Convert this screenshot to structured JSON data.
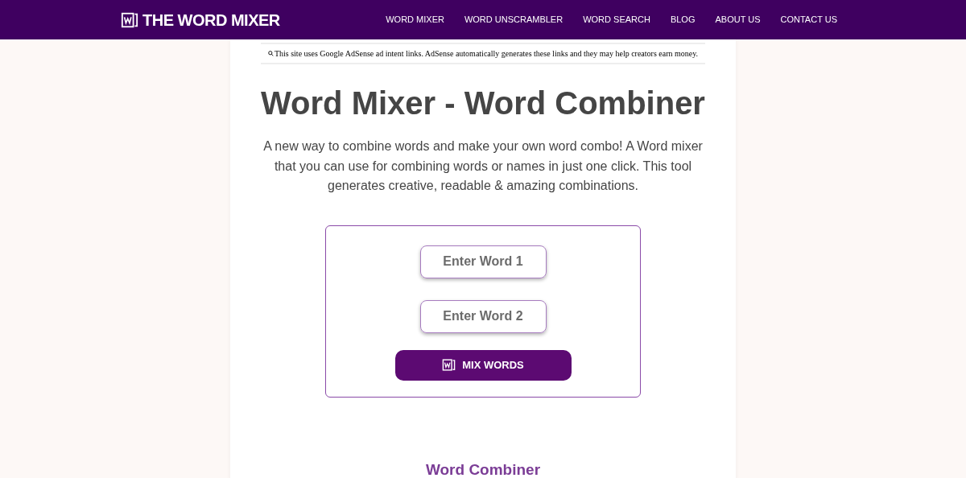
{
  "header": {
    "logo": "THE WORD MIXER",
    "nav": [
      {
        "label": "WORD MIXER"
      },
      {
        "label": "WORD UNSCRAMBLER"
      },
      {
        "label": "WORD SEARCH"
      },
      {
        "label": "BLOG"
      },
      {
        "label": "ABOUT US"
      },
      {
        "label": "CONTACT US"
      }
    ]
  },
  "notice": "This site uses Google AdSense ad intent links. AdSense automatically generates these links and they may help creators earn money.",
  "title": "Word Mixer - Word Combiner",
  "intro": "A new way to combine words and make your own word combo! A Word mixer that you can use for combining words or names in just one click. This tool generates creative, readable & amazing combinations.",
  "form": {
    "fields": [
      {
        "placeholder": "Enter Word 1"
      },
      {
        "placeholder": "Enter Word 2"
      }
    ],
    "button": "MIX WORDS"
  },
  "section_heading": "Word Combiner"
}
